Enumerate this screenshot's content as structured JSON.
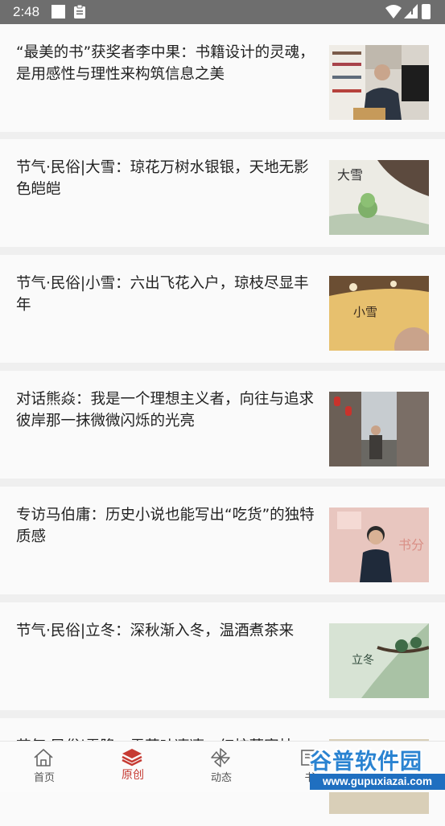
{
  "status_bar": {
    "time": "2:48"
  },
  "articles": [
    {
      "title": "“最美的书”获奖者李中果：书籍设计的灵魂，是用感性与理性来构筑信息之美",
      "thumb": "photo-man-at-desk"
    },
    {
      "title": "节气·民俗|大雪：琼花万树水银银，天地无影色皑皑",
      "thumb": "illustration-daxue",
      "thumb_text": "大雪"
    },
    {
      "title": "节气·民俗|小雪：六出飞花入户，琼枝尽显丰年",
      "thumb": "illustration-xiaoxue",
      "thumb_text": "小雪"
    },
    {
      "title": "对话熊焱：我是一个理想主义者，向往与追求彼岸那一抹微微闪烁的光亮",
      "thumb": "photo-man-in-alley"
    },
    {
      "title": "专访马伯庸：历史小说也能写出“吃货”的独特质感",
      "thumb": "photo-speaker-on-stage",
      "thumb_text": "书分"
    },
    {
      "title": "节气·民俗|立冬：深秋渐入冬，温酒煮茶来",
      "thumb": "illustration-lidong",
      "thumb_text": "立冬"
    },
    {
      "title": "节气·民俗|霜降：霜草叶凄凄，红柿落寒枝",
      "thumb": "partial-thumb"
    }
  ],
  "tab_bar": {
    "tabs": [
      {
        "label": "首页",
        "icon": "house-icon",
        "active": false
      },
      {
        "label": "原创",
        "icon": "layers-icon",
        "active": true
      },
      {
        "label": "动态",
        "icon": "pinwheel-icon",
        "active": false
      },
      {
        "label": "书",
        "icon": "book-icon",
        "active": false
      }
    ]
  },
  "watermark": {
    "line1": "谷普软件园",
    "line2": "www.gupuxiazai.com"
  },
  "colors": {
    "accent": "#c63b33",
    "status_bar": "#6e6e6e",
    "watermark_blue": "#2a83d1"
  }
}
